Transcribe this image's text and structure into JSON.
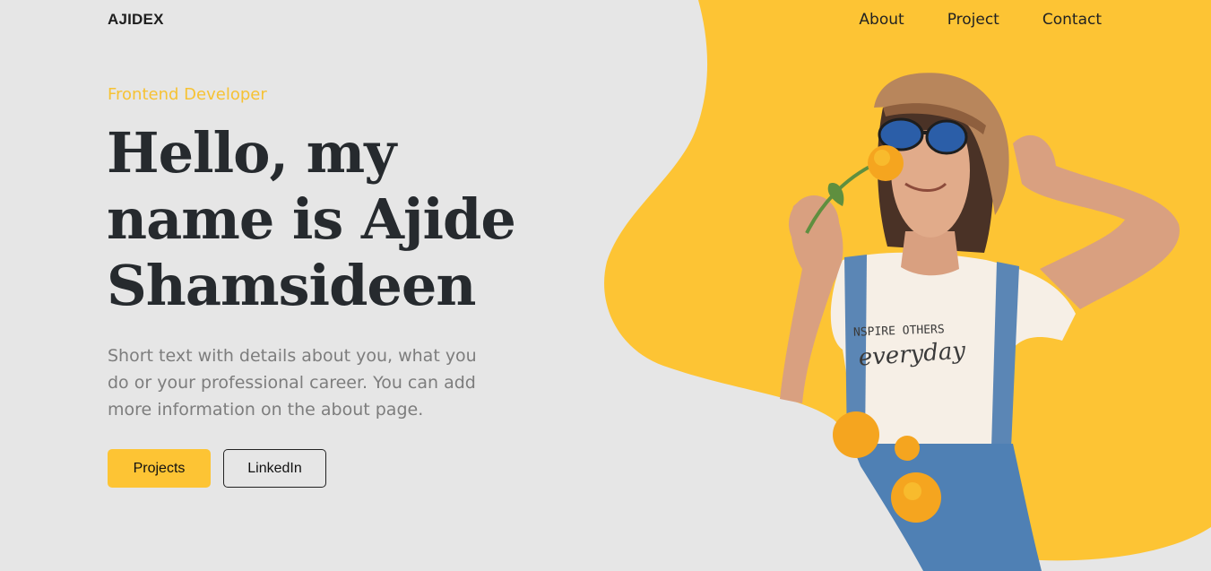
{
  "nav": {
    "brand": "AJIDEX",
    "links": [
      "About",
      "Project",
      "Contact"
    ]
  },
  "hero": {
    "subtitle": "Frontend Developer",
    "headline_lines": [
      "Hello, my",
      "name is Ajide",
      "Shamsideen"
    ],
    "description": "Short text with details about you, what you do or your professional career. You can add more information on the about page.",
    "buttons": {
      "projects": "Projects",
      "linkedin": "LinkedIn"
    }
  },
  "photo": {
    "shirt_text_top": "NSPIRE OTHERS",
    "shirt_text_script": "everyday"
  },
  "colors": {
    "background": "#e6e6e6",
    "accent": "#fdc434",
    "heading": "#262a2e",
    "body_text": "#7d7d7d"
  }
}
